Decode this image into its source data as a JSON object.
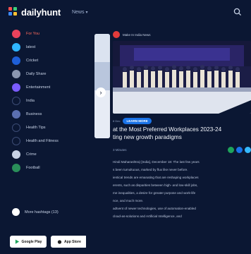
{
  "header": {
    "logo_text": "dailyhunt",
    "language": "News",
    "logo_colors": [
      "#ff4f4f",
      "#3ad07a",
      "#3d8bff",
      "#ffc233"
    ]
  },
  "sidebar": {
    "items": [
      {
        "label": "For You",
        "color": "#e9425c",
        "active": true
      },
      {
        "label": "latest",
        "color": "#2fb6ff"
      },
      {
        "label": "Cricket",
        "color": "#1e5fd8"
      },
      {
        "label": "Daily Share",
        "color": "#8a96b0"
      },
      {
        "label": "Entertainment",
        "color": "#7b5cff"
      },
      {
        "label": "India",
        "color": "#0b1733"
      },
      {
        "label": "Business",
        "color": "#5b6fb0"
      },
      {
        "label": "Health Tips",
        "color": "#0b1733"
      },
      {
        "label": "Health and Fitness",
        "color": "#0b1733"
      },
      {
        "label": "Crime",
        "color": "#c7d2e6"
      },
      {
        "label": "Football",
        "color": "#2a8f5a"
      }
    ],
    "more_label": "More hashtags (13)",
    "store_buttons": [
      "Google Play",
      "App Store"
    ]
  },
  "article": {
    "publisher": "Make In India News",
    "time": "",
    "meta_text": "8 Dec",
    "pill_label": "LEARN MORE",
    "headline_line1": "at the Most Preferred Workplaces 2023-24",
    "headline_line2": "ting new growth paradigms",
    "byline": "3 Minutes",
    "body_lines": [
      "Hindi Maharashtra) [India], December 18: The last few years",
      "s been tumultuous, marked by flux like never before.",
      "ientical trends are emanating that are reshaping workplaces",
      "erents, such as disparities between high- and low-skill jobs,",
      "me inequalities, a desire for greater purpose and work-life",
      "nce, and much more.",
      "adtvent of newer technologies, use of automation-enabled",
      "cloud-as-solutions and Artificial Intelligence, and"
    ],
    "share_colors": [
      "#1ea35b",
      "#1a73e8",
      "#35b9ff"
    ]
  }
}
